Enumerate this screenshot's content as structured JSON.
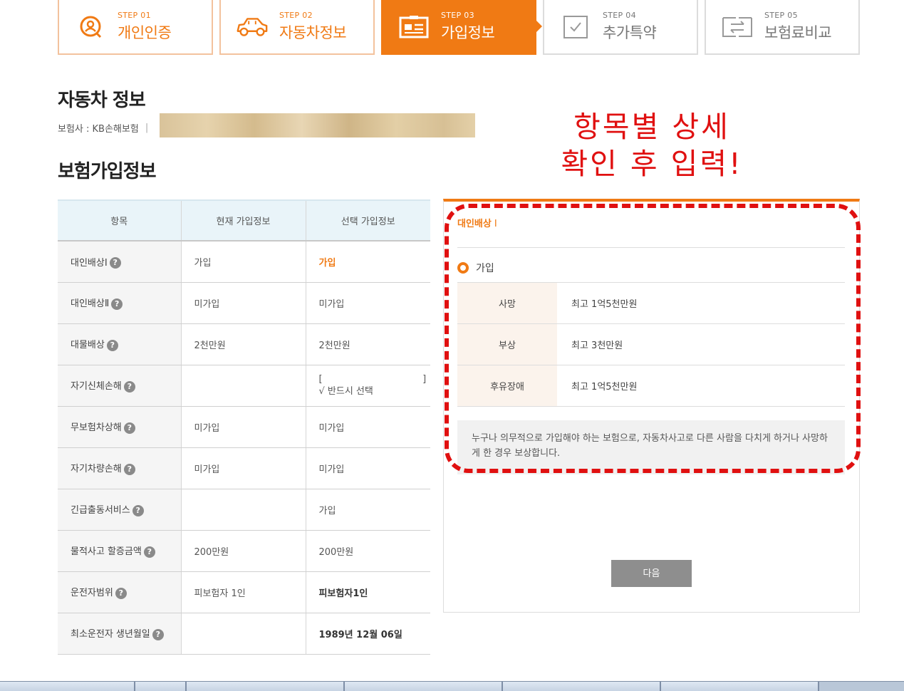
{
  "steps": [
    {
      "num": "STEP 01",
      "name": "개인인증",
      "icon": "person-search-icon",
      "state": "done"
    },
    {
      "num": "STEP 02",
      "name": "자동차정보",
      "icon": "car-icon",
      "state": "done"
    },
    {
      "num": "STEP 03",
      "name": "가입정보",
      "icon": "id-card-icon",
      "state": "active"
    },
    {
      "num": "STEP 04",
      "name": "추가특약",
      "icon": "checkbox-icon",
      "state": "todo"
    },
    {
      "num": "STEP 05",
      "name": "보험료비교",
      "icon": "compare-icon",
      "state": "todo"
    }
  ],
  "car_info": {
    "title": "자동차 정보",
    "insurer": "보험사 : KB손해보험",
    "separator": "|"
  },
  "annotation": {
    "line1": "항목별 상세",
    "line2": "확인 후 입력!"
  },
  "subscription": {
    "title": "보험가입정보",
    "headers": [
      "항목",
      "현재 가입정보",
      "선택 가입정보"
    ],
    "rows": [
      {
        "item": "대인배상Ⅰ",
        "current": "가입",
        "selected": "가입"
      },
      {
        "item": "대인배상Ⅱ",
        "current": "미가입",
        "selected": "미가입"
      },
      {
        "item": "대물배상",
        "current": "2천만원",
        "selected": "2천만원"
      },
      {
        "item": "자기신체손해",
        "current": "",
        "selected_line1": "[                                  ]",
        "selected_line2": "√ 반드시 선택"
      },
      {
        "item": "무보험차상해",
        "current": "미가입",
        "selected": "미가입"
      },
      {
        "item": "자기차량손해",
        "current": "미가입",
        "selected": "미가입"
      },
      {
        "item": "긴급출동서비스",
        "current": "",
        "selected": "가입"
      },
      {
        "item": "물적사고 할증금액",
        "current": "200만원",
        "selected": "200만원"
      },
      {
        "item": "운전자범위",
        "current": "피보험자 1인",
        "selected": "피보험자1인"
      },
      {
        "item": "최소운전자 생년월일",
        "current": "",
        "selected": "1989년 12월 06일"
      }
    ]
  },
  "detail_panel": {
    "title": "대인배상",
    "title_suffix": "I",
    "option": "가입",
    "rows": [
      {
        "label": "사망",
        "value": "최고 1억5천만원"
      },
      {
        "label": "부상",
        "value": "최고 3천만원"
      },
      {
        "label": "후유장애",
        "value": "최고 1억5천만원"
      }
    ],
    "description": "누구나 의무적으로 가입해야 하는 보험으로, 자동차사고로 다른 사람을 다치게 하거나 사망하게 한 경우 보상합니다.",
    "next_label": "다음"
  },
  "help_icon_glyph": "?",
  "colors": {
    "accent": "#f07a14",
    "annotation": "#e01010",
    "header_bg": "#e9f4f9"
  }
}
